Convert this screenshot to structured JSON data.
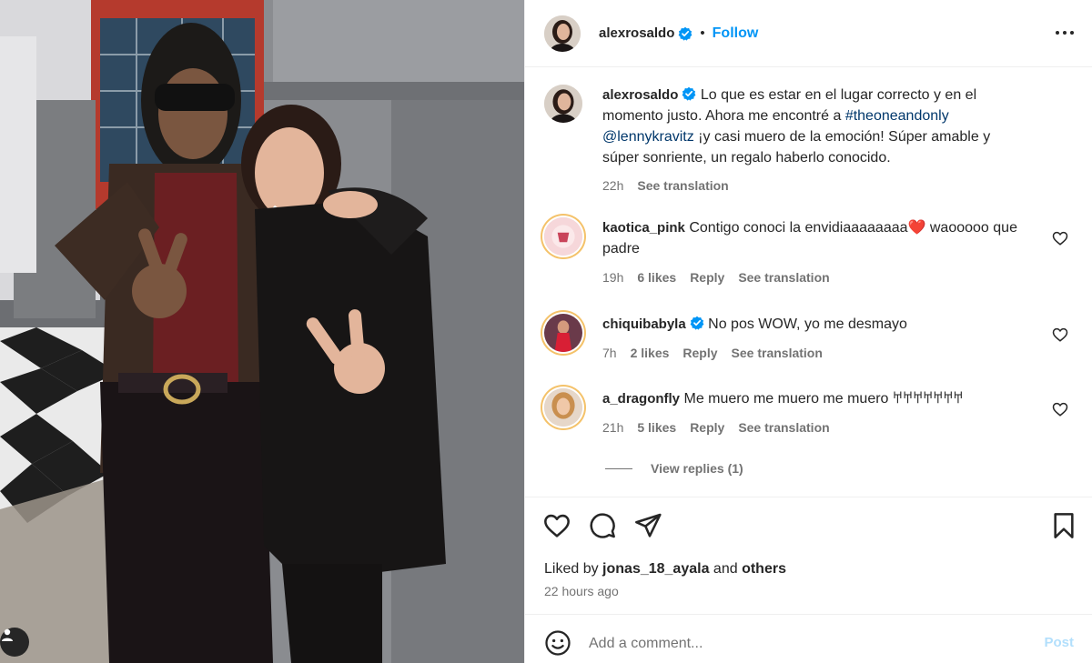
{
  "post": {
    "author": "alexrosaldo",
    "follow_label": "Follow",
    "separator": "•",
    "more_icon": "more-horizontal-icon"
  },
  "caption": {
    "username": "alexrosaldo",
    "text_before": "Lo que es estar en el lugar correcto y en el momento justo. Ahora me encontré a ",
    "hashtag": "#theoneandonly",
    "mention": "@lennykravitz",
    "text_after": " ¡y casi muero de la emoción! Súper amable y súper sonriente, un regalo haberlo conocido.",
    "time": "22h",
    "see_translation": "See translation"
  },
  "comments": [
    {
      "username": "kaotica_pink",
      "verified": false,
      "text": "Contigo conoci la envidiaaaaaaaa❤️ waooooo que padre",
      "time": "19h",
      "likes": "6 likes",
      "reply": "Reply",
      "see_translation": "See translation"
    },
    {
      "username": "chiquibabyla",
      "verified": true,
      "text": "No pos WOW, yo me desmayo",
      "time": "7h",
      "likes": "2 likes",
      "reply": "Reply",
      "see_translation": "See translation"
    },
    {
      "username": "a_dragonfly",
      "verified": false,
      "text": "Me muero me muero me muero 𐀀𐀀𐀀𐀀𐀀𐀀𐀀",
      "time": "21h",
      "likes": "5 likes",
      "reply": "Reply",
      "see_translation": "See translation"
    }
  ],
  "view_replies": "View replies (1)",
  "likes": {
    "prefix": "Liked by",
    "user": "jonas_18_ayala",
    "middle": "and",
    "others": "others"
  },
  "post_time": "22 hours ago",
  "add_comment": {
    "placeholder": "Add a comment...",
    "post_label": "Post"
  },
  "colors": {
    "accent": "#0095f6",
    "post_disabled": "#b2dffc",
    "secondary_text": "#737373",
    "link": "#00376b"
  },
  "icons": [
    "heart-icon",
    "comment-icon",
    "share-icon",
    "bookmark-icon",
    "emoji-icon",
    "verified-badge-icon",
    "tag-user-icon"
  ]
}
